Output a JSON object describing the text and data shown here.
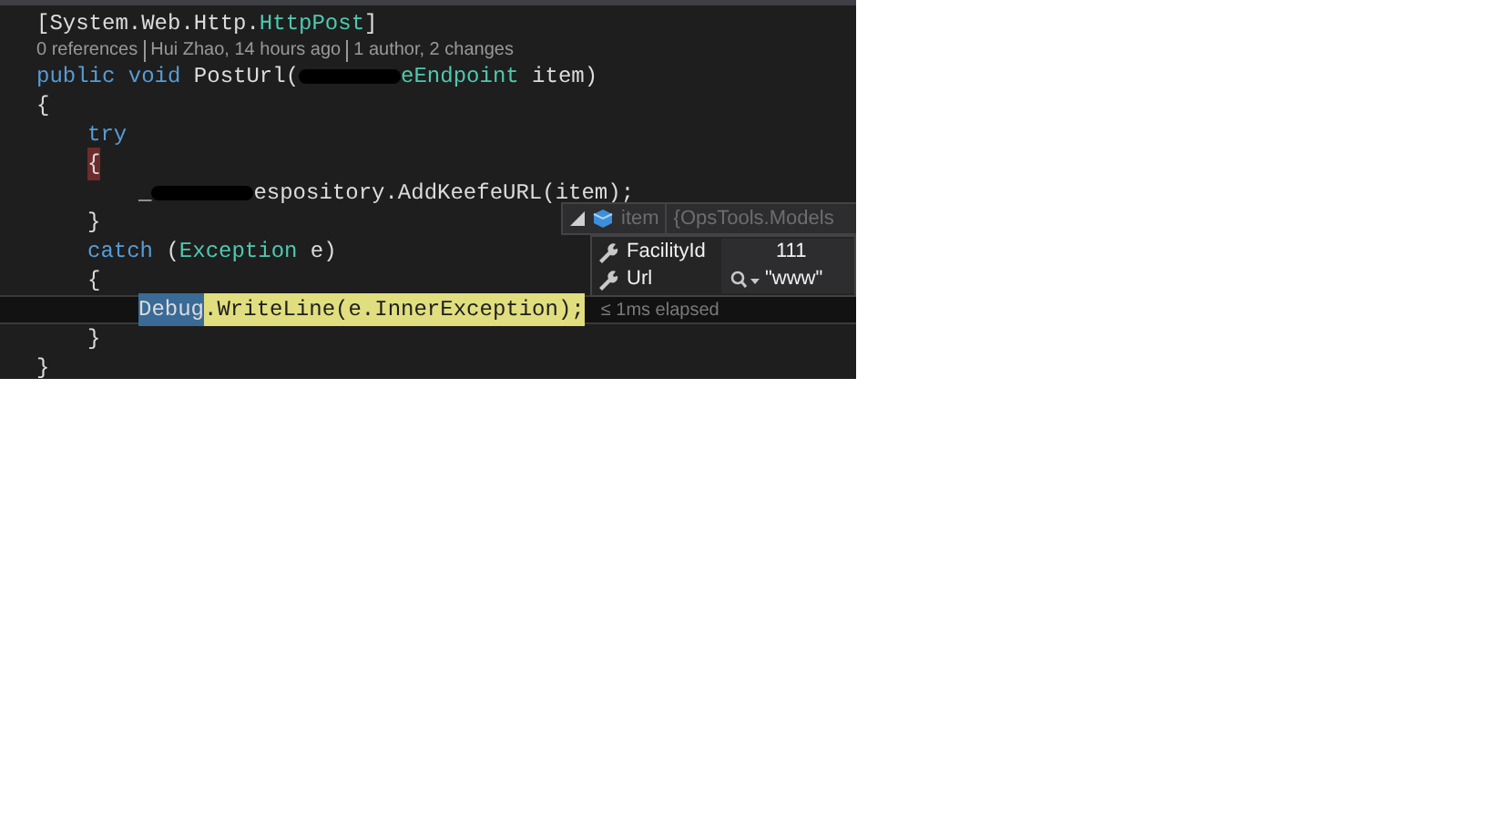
{
  "editor": {
    "lines": [
      {
        "kind": "code",
        "tokens": [
          {
            "text": "[System.Web.Http.",
            "kind": "plain"
          },
          {
            "text": "HttpPost",
            "kind": "type"
          },
          {
            "text": "]",
            "kind": "plain"
          }
        ]
      },
      {
        "kind": "codelens",
        "items": [
          "0 references",
          "Hui Zhao, 14 hours ago",
          "1 author, 2 changes"
        ]
      },
      {
        "kind": "code",
        "tokens": [
          {
            "text": "public void",
            "kind": "keyword"
          },
          {
            "text": " PostUrl(",
            "kind": "plain"
          },
          {
            "kind": "redacted"
          },
          {
            "text": "eEndpoint",
            "kind": "type"
          },
          {
            "text": " item)",
            "kind": "plain"
          }
        ]
      },
      {
        "kind": "code",
        "tokens": [
          {
            "text": "{",
            "kind": "plain"
          }
        ],
        "children": [
          {
            "kind": "code",
            "tokens": [
              {
                "text": "try",
                "kind": "keyword"
              }
            ]
          },
          {
            "kind": "code",
            "tokens": [
              {
                "text": "{",
                "kind": "brace-match"
              }
            ],
            "children": [
              {
                "kind": "code",
                "tokens": [
                  {
                    "text": "_",
                    "kind": "plain"
                  },
                  {
                    "kind": "redacted"
                  },
                  {
                    "text": "espository.AddKeefeURL(item);",
                    "kind": "plain"
                  }
                ]
              }
            ]
          },
          {
            "kind": "code",
            "tokens": [
              {
                "text": "}",
                "kind": "plain"
              }
            ]
          },
          {
            "kind": "code",
            "tokens": [
              {
                "text": "catch",
                "kind": "keyword"
              },
              {
                "text": " (",
                "kind": "plain"
              },
              {
                "text": "Exception",
                "kind": "type"
              },
              {
                "text": " e)",
                "kind": "plain"
              }
            ]
          },
          {
            "kind": "code",
            "tokens": [
              {
                "text": "{",
                "kind": "plain"
              }
            ],
            "children": [
              {
                "kind": "code",
                "current": true,
                "tokens": [
                  {
                    "text": "Debug",
                    "kind": "selected"
                  },
                  {
                    "text": ".WriteLine(e.InnerException);",
                    "kind": "executing"
                  }
                ],
                "perf_tip": "≤ 1ms elapsed"
              }
            ]
          },
          {
            "kind": "code",
            "tokens": [
              {
                "text": "}",
                "kind": "plain"
              }
            ]
          }
        ]
      },
      {
        "kind": "code",
        "tokens": [
          {
            "text": "}",
            "kind": "plain"
          }
        ]
      }
    ]
  },
  "datatip": {
    "name": "item",
    "value": "{OpsTools.Models",
    "expanded": true,
    "members": [
      {
        "name": "FacilityId",
        "value": "111",
        "visualizer": false
      },
      {
        "name": "Url",
        "value": "\"www\"",
        "visualizer": true
      }
    ]
  }
}
